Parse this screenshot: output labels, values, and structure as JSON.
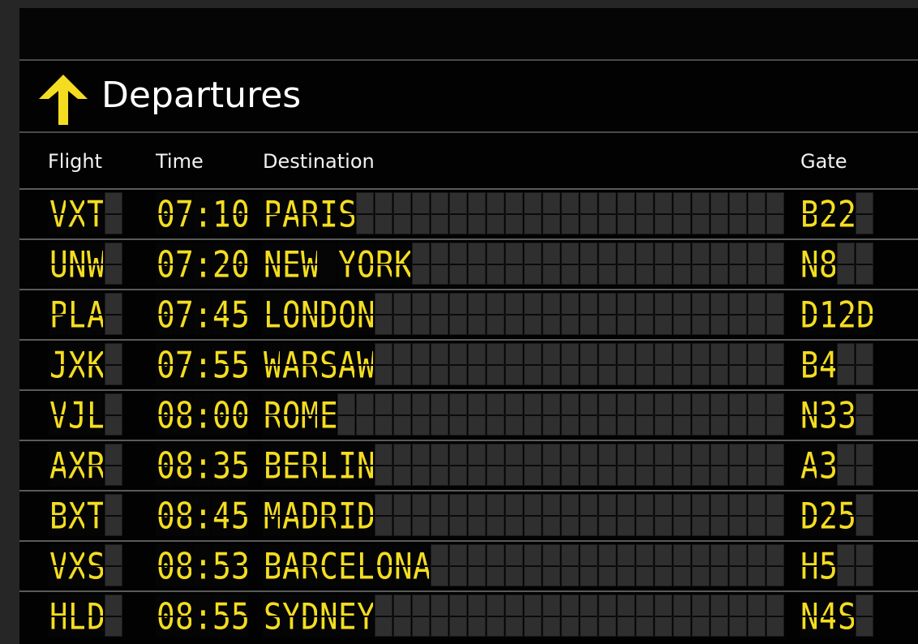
{
  "board": {
    "title": "Departures",
    "arrow_icon": "up-arrow-icon",
    "accent_color": "#f4dd20",
    "headers": {
      "flight": "Flight",
      "time": "Time",
      "destination": "Destination",
      "gate": "Gate"
    },
    "rows": [
      {
        "flight": "VXT",
        "time": "07:10",
        "destination": "PARIS",
        "gate": "B22"
      },
      {
        "flight": "UNW",
        "time": "07:20",
        "destination": "NEW YORK",
        "gate": "N8"
      },
      {
        "flight": "PLA",
        "time": "07:45",
        "destination": "LONDON",
        "gate": "D12D"
      },
      {
        "flight": "JXK",
        "time": "07:55",
        "destination": "WARSAW",
        "gate": "B4"
      },
      {
        "flight": "VJL",
        "time": "08:00",
        "destination": "ROME",
        "gate": "N33"
      },
      {
        "flight": "AXR",
        "time": "08:35",
        "destination": "BERLIN",
        "gate": "A3"
      },
      {
        "flight": "BXT",
        "time": "08:45",
        "destination": "MADRID",
        "gate": "D25"
      },
      {
        "flight": "VXS",
        "time": "08:53",
        "destination": "BARCELONA",
        "gate": "H5"
      },
      {
        "flight": "HLD",
        "time": "08:55",
        "destination": "SYDNEY",
        "gate": "N4S"
      }
    ]
  }
}
